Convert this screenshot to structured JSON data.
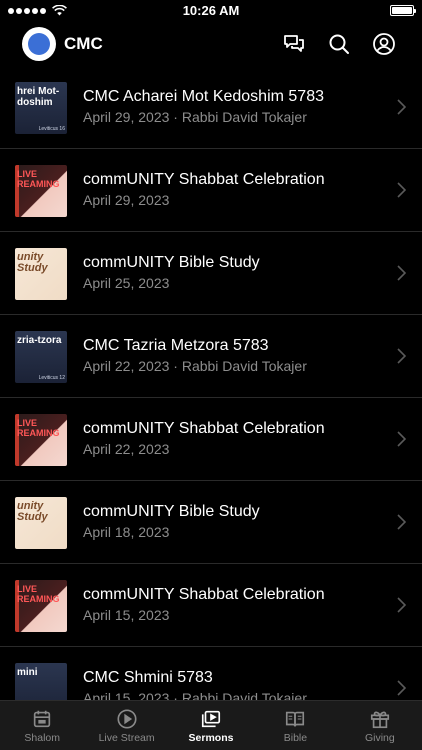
{
  "status": {
    "time": "10:26 AM"
  },
  "header": {
    "title": "CMC"
  },
  "sermons": [
    {
      "title": "CMC Acharei Mot Kedoshim 5783",
      "meta": "April 29, 2023 · Rabbi David Tokajer",
      "thumb_text": "hrei Mot-doshim",
      "thumb_sub": "Leviticus 16",
      "thumb_style": "dark"
    },
    {
      "title": "commUNITY Shabbat Celebration",
      "meta": "April 29, 2023",
      "thumb_text": "LIVE REAMING",
      "thumb_sub": "",
      "thumb_style": "red"
    },
    {
      "title": "commUNITY Bible Study",
      "meta": "April 25, 2023",
      "thumb_text": "unity Study",
      "thumb_sub": "",
      "thumb_style": "study"
    },
    {
      "title": "CMC Tazria Metzora 5783",
      "meta": "April 22, 2023 · Rabbi David Tokajer",
      "thumb_text": "zria-tzora",
      "thumb_sub": "Leviticus 12",
      "thumb_style": "dark"
    },
    {
      "title": "commUNITY Shabbat Celebration",
      "meta": "April 22, 2023",
      "thumb_text": "LIVE REAMING",
      "thumb_sub": "",
      "thumb_style": "red"
    },
    {
      "title": "commUNITY Bible Study",
      "meta": "April 18, 2023",
      "thumb_text": "unity Study",
      "thumb_sub": "",
      "thumb_style": "study"
    },
    {
      "title": "commUNITY Shabbat Celebration",
      "meta": "April 15, 2023",
      "thumb_text": "LIVE REAMING",
      "thumb_sub": "",
      "thumb_style": "red"
    },
    {
      "title": "CMC Shmini 5783",
      "meta": "April 15, 2023 · Rabbi David Tokajer",
      "thumb_text": "mini",
      "thumb_sub": "",
      "thumb_style": "dark"
    }
  ],
  "tabs": [
    {
      "label": "Shalom",
      "icon": "calendar-icon"
    },
    {
      "label": "Live Stream",
      "icon": "play-icon"
    },
    {
      "label": "Sermons",
      "icon": "video-library-icon"
    },
    {
      "label": "Bible",
      "icon": "book-icon"
    },
    {
      "label": "Giving",
      "icon": "gift-icon"
    }
  ],
  "active_tab": "Sermons",
  "colors": {
    "background": "#000000",
    "subtitle": "#8d8d8d",
    "tab_bar": "#1a1a1a"
  }
}
